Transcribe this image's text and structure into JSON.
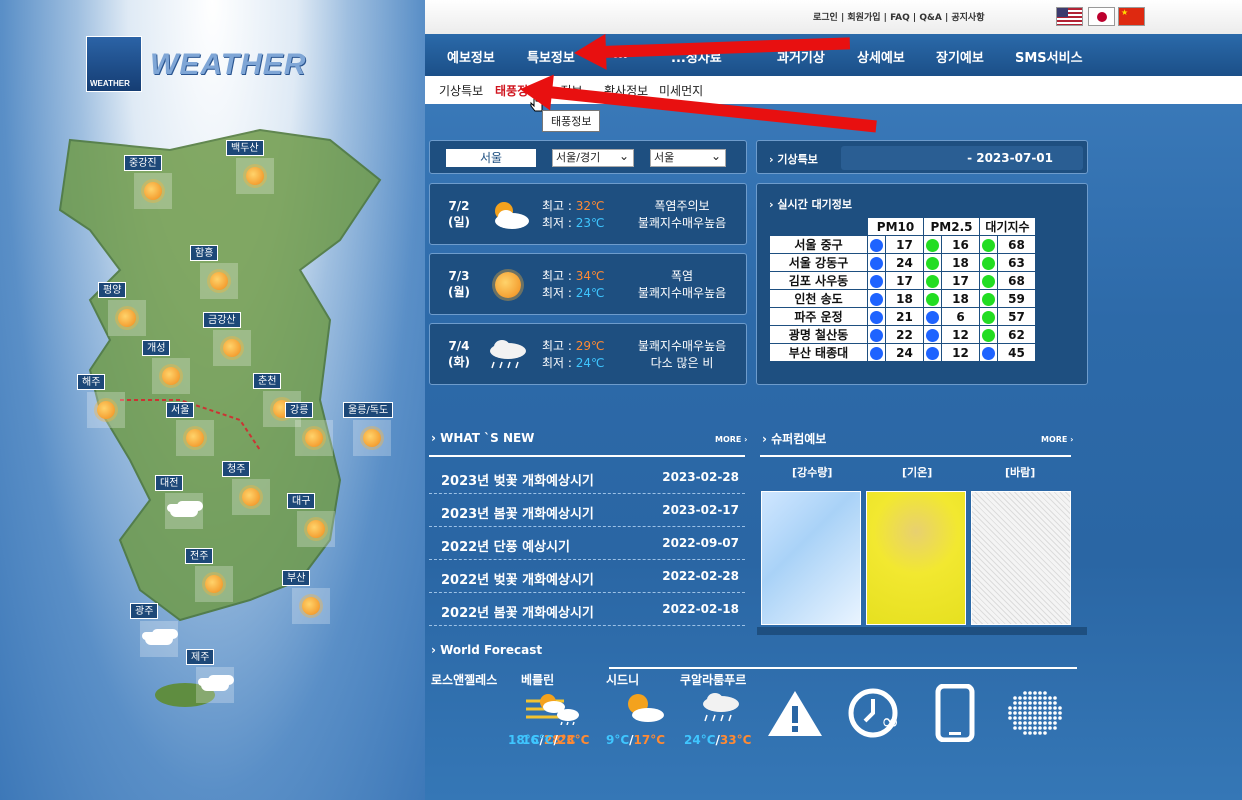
{
  "logo": {
    "brand": "WEATHER",
    "box_text": "WEATHER"
  },
  "map": {
    "cities": [
      {
        "name": "중강진",
        "icon": "sun-icon"
      },
      {
        "name": "백두산",
        "icon": "sun-icon"
      },
      {
        "name": "함흥",
        "icon": "sun-icon"
      },
      {
        "name": "평양",
        "icon": "sun-icon"
      },
      {
        "name": "금강산",
        "icon": "sun-icon"
      },
      {
        "name": "개성",
        "icon": "sun-icon"
      },
      {
        "name": "해주",
        "icon": "sun-icon"
      },
      {
        "name": "춘천",
        "icon": "sun-icon"
      },
      {
        "name": "서울",
        "icon": "sun-icon"
      },
      {
        "name": "강릉",
        "icon": "sun-icon"
      },
      {
        "name": "울릉/독도",
        "icon": "sun-icon"
      },
      {
        "name": "청주",
        "icon": "sun-icon"
      },
      {
        "name": "대전",
        "icon": "cloud-icon"
      },
      {
        "name": "대구",
        "icon": "sun-icon"
      },
      {
        "name": "전주",
        "icon": "sun-icon"
      },
      {
        "name": "부산",
        "icon": "sun-icon"
      },
      {
        "name": "광주",
        "icon": "cloud-icon"
      },
      {
        "name": "제주",
        "icon": "cloud-icon"
      }
    ]
  },
  "toplinks": "로그인 | 회원가입 | FAQ | Q&A | 공지사항",
  "menu": [
    "예보정보",
    "특보정보",
    "",
    "",
    "과거기상",
    "상세예보",
    "장기예보",
    "SMS서비스"
  ],
  "menu_partial": [
    "...",
    "...정자료"
  ],
  "submenu": [
    "기상특보",
    "태풍정보",
    "...정보",
    "황사정보",
    "미세먼지"
  ],
  "tooltip": "태풍정보",
  "location": {
    "current": "서울",
    "region": "서울/경기",
    "city": "서울"
  },
  "forecast": [
    {
      "date": "7/2",
      "dow": "(일)",
      "icon": "partly-cloudy-icon",
      "hi_label": "최고 : ",
      "hi": "32℃",
      "lo_label": "최저 : ",
      "lo": "23℃",
      "note1": "폭염주의보",
      "note2": "불쾌지수매우높음"
    },
    {
      "date": "7/3",
      "dow": "(월)",
      "icon": "sun-icon",
      "hi_label": "최고 : ",
      "hi": "34℃",
      "lo_label": "최저 : ",
      "lo": "24℃",
      "note1": "폭염",
      "note2": "불쾌지수매우높음"
    },
    {
      "date": "7/4",
      "dow": "(화)",
      "icon": "rain-icon",
      "hi_label": "최고 : ",
      "hi": "29℃",
      "lo_label": "최저 : ",
      "lo": "24℃",
      "note1": "불쾌지수매우높음",
      "note2": "다소 많은 비"
    }
  ],
  "special": {
    "label": "기상특보",
    "date": "- 2023-07-01"
  },
  "air": {
    "title": "실시간 대기정보",
    "headers": [
      "PM10",
      "PM2.5",
      "대기지수"
    ],
    "rows": [
      {
        "name": "서울 중구",
        "pm10": "17",
        "pm10c": "#1e63ff",
        "pm25": "16",
        "pm25c": "#22dd22",
        "idx": "68",
        "idxc": "#22dd22"
      },
      {
        "name": "서울 강동구",
        "pm10": "24",
        "pm10c": "#1e63ff",
        "pm25": "18",
        "pm25c": "#22dd22",
        "idx": "63",
        "idxc": "#22dd22"
      },
      {
        "name": "김포 사우동",
        "pm10": "17",
        "pm10c": "#1e63ff",
        "pm25": "17",
        "pm25c": "#22dd22",
        "idx": "68",
        "idxc": "#22dd22"
      },
      {
        "name": "인천 송도",
        "pm10": "18",
        "pm10c": "#1e63ff",
        "pm25": "18",
        "pm25c": "#22dd22",
        "idx": "59",
        "idxc": "#22dd22"
      },
      {
        "name": "파주 운정",
        "pm10": "21",
        "pm10c": "#1e63ff",
        "pm25": "6",
        "pm25c": "#1e63ff",
        "idx": "57",
        "idxc": "#22dd22"
      },
      {
        "name": "광명 철산동",
        "pm10": "22",
        "pm10c": "#1e63ff",
        "pm25": "12",
        "pm25c": "#1e63ff",
        "idx": "62",
        "idxc": "#22dd22"
      },
      {
        "name": "부산 태종대",
        "pm10": "24",
        "pm10c": "#1e63ff",
        "pm25": "12",
        "pm25c": "#1e63ff",
        "idx": "45",
        "idxc": "#1e63ff"
      }
    ]
  },
  "news": {
    "title": "WHAT `S NEW",
    "more": "MORE ›",
    "items": [
      {
        "title": "2023년 벚꽃 개화예상시기",
        "date": "2023-02-28"
      },
      {
        "title": "2023년 봄꽃 개화예상시기",
        "date": "2023-02-17"
      },
      {
        "title": "2022년 단풍 예상시기",
        "date": "2022-09-07"
      },
      {
        "title": "2022년 벚꽃 개화예상시기",
        "date": "2022-02-28"
      },
      {
        "title": "2022년 봄꽃 개화예상시기",
        "date": "2022-02-18"
      }
    ]
  },
  "super": {
    "title": "슈퍼컴예보",
    "more": "MORE ›",
    "caps": [
      "[강수량]",
      "[기온]",
      "[바람]"
    ]
  },
  "world": {
    "title": "World Forecast",
    "cities": [
      {
        "name": "로스앤젤레스",
        "icon": "haze-icon",
        "lo": "18°C",
        "hi": "28°C"
      },
      {
        "name": "베를린",
        "icon": "partly-cloudy-rain-icon",
        "lo": "16°C",
        "hi": "23°C"
      },
      {
        "name": "시드니",
        "icon": "partly-cloudy-icon",
        "lo": "9°C",
        "hi": "17°C"
      },
      {
        "name": "쿠알라룸푸르",
        "icon": "rain-icon",
        "lo": "24°C",
        "hi": "33°C"
      }
    ]
  },
  "colors": {
    "menu": "#1b4f88",
    "hi": "#ff8a33",
    "lo": "#3fc6ff",
    "active": "#d0151f",
    "arrow": "#e81010"
  }
}
